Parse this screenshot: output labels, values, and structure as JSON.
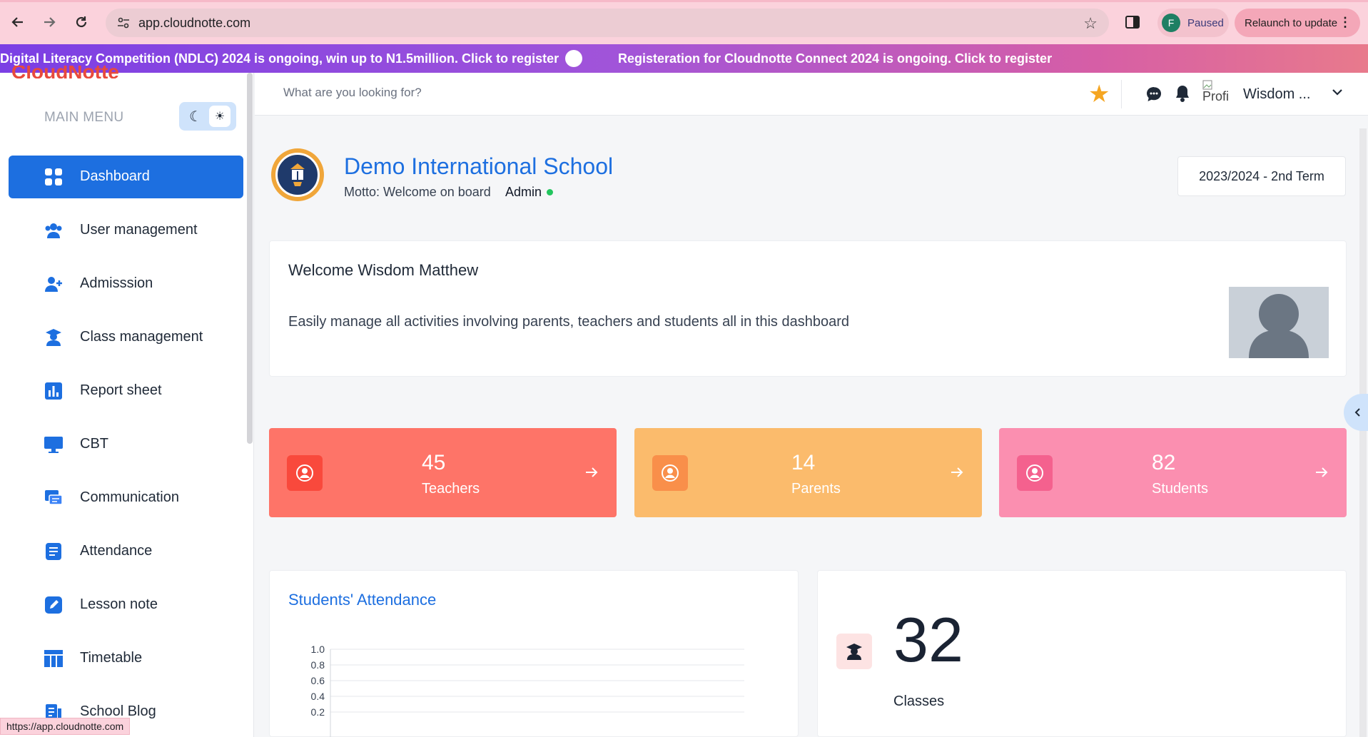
{
  "browser": {
    "url": "app.cloudnotte.com",
    "profile_initial": "F",
    "profile_status": "Paused",
    "relaunch_label": "Relaunch to update",
    "status_url": "https://app.cloudnotte.com"
  },
  "banner": {
    "message1": "Digital Literacy Competition (NDLC) 2024 is ongoing, win up to N1.5million. Click to register",
    "message2": "Registeration for Cloudnotte Connect 2024 is ongoing. Click to register"
  },
  "sidebar": {
    "logo_text": "CloudNotte",
    "menu_heading": "MAIN MENU",
    "items": [
      {
        "label": "Dashboard",
        "icon": "grid-icon",
        "active": true
      },
      {
        "label": "User management",
        "icon": "users-icon"
      },
      {
        "label": "Admisssion",
        "icon": "user-plus-icon"
      },
      {
        "label": "Class management",
        "icon": "graduate-icon"
      },
      {
        "label": "Report sheet",
        "icon": "bar-chart-icon"
      },
      {
        "label": "CBT",
        "icon": "monitor-icon"
      },
      {
        "label": "Communication",
        "icon": "messages-icon"
      },
      {
        "label": "Attendance",
        "icon": "list-icon"
      },
      {
        "label": "Lesson note",
        "icon": "edit-icon"
      },
      {
        "label": "Timetable",
        "icon": "table-icon"
      },
      {
        "label": "School Blog",
        "icon": "blog-icon"
      }
    ]
  },
  "topbar": {
    "search_placeholder": "What are you looking for?",
    "profile_alt": "Profi",
    "username": "Wisdom ..."
  },
  "school": {
    "name": "Demo International School",
    "motto": "Motto: Welcome on board",
    "role": "Admin",
    "term": "2023/2024 - 2nd Term"
  },
  "welcome": {
    "title": "Welcome Wisdom Matthew",
    "text": "Easily manage all activities involving parents, teachers and students all in this dashboard"
  },
  "stats": [
    {
      "value": "45",
      "label": "Teachers",
      "color": "#fe7468",
      "icon_bg": "#f9493c"
    },
    {
      "value": "14",
      "label": "Parents",
      "color": "#fbbb6c",
      "icon_bg": "#f98f4a"
    },
    {
      "value": "82",
      "label": "Students",
      "color": "#fb8fb0",
      "icon_bg": "#f4618e"
    }
  ],
  "attendance": {
    "title": "Students' Attendance"
  },
  "chart_data": {
    "type": "line",
    "title": "Students' Attendance",
    "y_ticks": [
      "1.0",
      "0.8",
      "0.6",
      "0.4",
      "0.2"
    ],
    "ylim": [
      0,
      1.0
    ],
    "grid": true,
    "series": []
  },
  "classes": {
    "value": "32",
    "label": "Classes"
  },
  "colors": {
    "primary": "#1d6fe0",
    "star": "#f5a623",
    "online": "#22c55e"
  }
}
